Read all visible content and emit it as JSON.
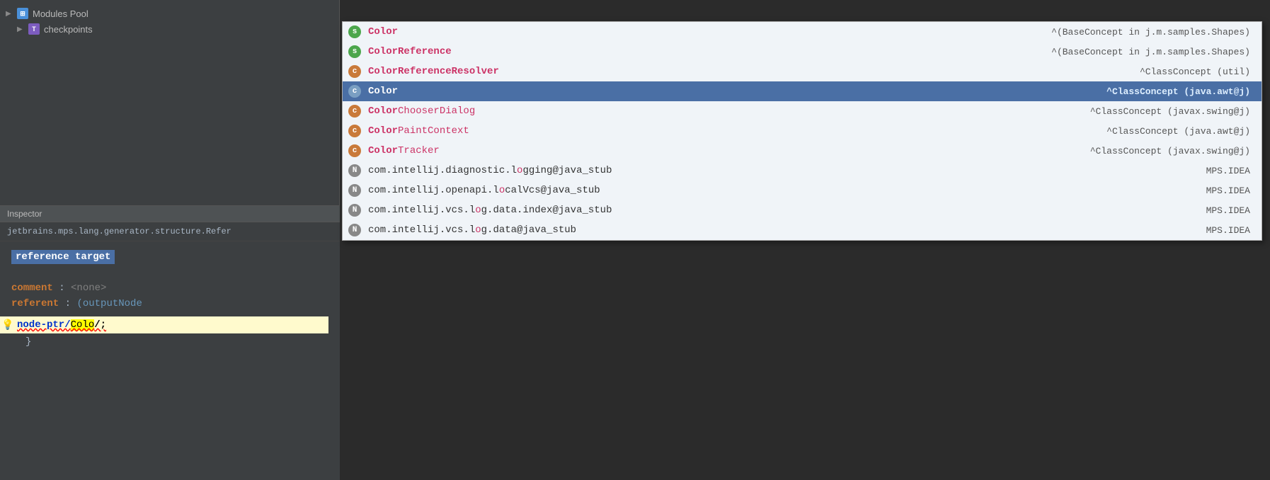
{
  "sidebar": {
    "items": [
      {
        "label": "Modules Pool",
        "icon": "modules",
        "arrow": "▶"
      },
      {
        "label": "checkpoints",
        "icon": "T",
        "arrow": "▶"
      }
    ]
  },
  "inspector": {
    "header": "Inspector",
    "path": "jetbrains.mps.lang.generator.structure.Refer",
    "reference_target": "reference target",
    "comment_label": "comment",
    "comment_value": "<none>",
    "referent_label": "referent",
    "referent_value": "(outputNode",
    "code_prefix": "node-ptr/",
    "code_highlight": "Colo",
    "code_suffix": "/;",
    "closing_brace": "}"
  },
  "autocomplete": {
    "items": [
      {
        "badge": "s",
        "badge_class": "badge-s",
        "name_bold": "Color",
        "name_rest": "",
        "type": "^(BaseConcept in j.m.samples.Shapes)",
        "type_bold": false,
        "selected": false
      },
      {
        "badge": "s",
        "badge_class": "badge-s",
        "name_bold": "Color",
        "name_rest": "Reference",
        "type": "^(BaseConcept in j.m.samples.Shapes)",
        "type_bold": false,
        "selected": false
      },
      {
        "badge": "c",
        "badge_class": "badge-c",
        "name_bold": "Color",
        "name_rest": "ReferenceResolver",
        "type": "^ClassConcept (util)",
        "type_bold": false,
        "selected": false
      },
      {
        "badge": "c",
        "badge_class": "badge-c",
        "name_bold": "Color",
        "name_rest": "",
        "type": "^ClassConcept (java.awt@j)",
        "type_bold": true,
        "selected": true
      },
      {
        "badge": "c",
        "badge_class": "badge-c",
        "name_bold": "Color",
        "name_rest": "ChooserDialog",
        "type": "^ClassConcept (javax.swing@j)",
        "type_bold": false,
        "selected": false
      },
      {
        "badge": "c",
        "badge_class": "badge-c",
        "name_bold": "Color",
        "name_rest": "PaintContext",
        "type": "^ClassConcept (java.awt@j)",
        "type_bold": false,
        "selected": false
      },
      {
        "badge": "c",
        "badge_class": "badge-c",
        "name_bold": "Color",
        "name_rest": "Tracker",
        "type": "^ClassConcept (javax.swing@j)",
        "type_bold": false,
        "selected": false
      },
      {
        "badge": "N",
        "badge_class": "badge-n",
        "name_prefix": "com.intellij.diagnostic.l",
        "name_highlight": "o",
        "name_suffix": "gging@java_stub",
        "type": "MPS.IDEA",
        "type_bold": false,
        "selected": false,
        "complex": true
      },
      {
        "badge": "N",
        "badge_class": "badge-n",
        "name_prefix": "com.intellij.openapi.l",
        "name_highlight": "o",
        "name_suffix": "calVcs@java_stub",
        "type": "MPS.IDEA",
        "type_bold": false,
        "selected": false,
        "complex": true
      },
      {
        "badge": "N",
        "badge_class": "badge-n",
        "name_prefix": "com.intellij.vcs.l",
        "name_highlight": "o",
        "name_suffix": "g.data.index@java_stub",
        "type": "MPS.IDEA",
        "type_bold": false,
        "selected": false,
        "complex": true
      },
      {
        "badge": "N",
        "badge_class": "badge-n",
        "name_prefix": "com.intellij.vcs.l",
        "name_highlight": "o",
        "name_suffix": "g.data@java_stub",
        "type": "MPS.IDEA",
        "type_bold": false,
        "selected": false,
        "complex": true,
        "truncated": true
      }
    ]
  },
  "colors": {
    "selected_bg": "#4a6fa5",
    "match_color": "#cc3366",
    "keyword_color": "#cc7832",
    "code_bg": "#fffacd"
  }
}
